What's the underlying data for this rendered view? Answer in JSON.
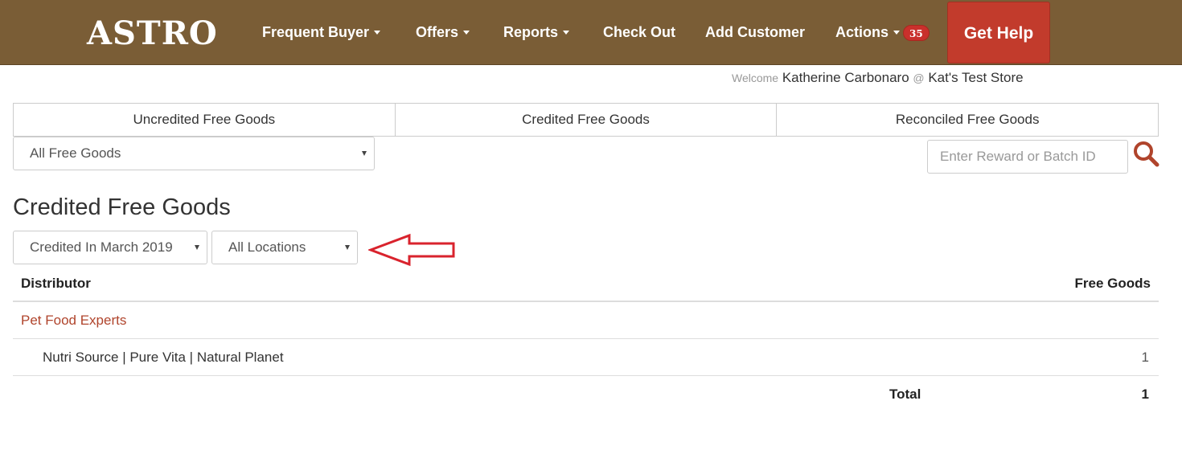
{
  "brand": {
    "logo": "ASTRO"
  },
  "nav": {
    "items": [
      {
        "label": "Frequent Buyer",
        "dropdown": true
      },
      {
        "label": "Offers",
        "dropdown": true
      },
      {
        "label": "Reports",
        "dropdown": true
      },
      {
        "label": "Check Out",
        "dropdown": false
      },
      {
        "label": "Add Customer",
        "dropdown": false
      },
      {
        "label": "Actions",
        "dropdown": true,
        "badge": "35"
      }
    ],
    "help_button": "Get Help"
  },
  "welcome": {
    "prefix": "Welcome",
    "user": "Katherine Carbonaro",
    "at": "@",
    "store": "Kat's Test Store"
  },
  "tabs": [
    {
      "label": "Uncredited Free Goods"
    },
    {
      "label": "Credited Free Goods"
    },
    {
      "label": "Reconciled Free Goods"
    }
  ],
  "filters": {
    "type_select": "All Free Goods",
    "search_placeholder": "Enter Reward or Batch ID",
    "period_select": "Credited In March 2019",
    "location_select": "All Locations"
  },
  "page_title": "Credited Free Goods",
  "table": {
    "headers": {
      "distributor": "Distributor",
      "free_goods": "Free Goods"
    },
    "groups": [
      {
        "distributor": "Pet Food Experts",
        "rows": [
          {
            "name": "Nutri Source | Pure Vita | Natural Planet",
            "free_goods": "1"
          }
        ]
      }
    ],
    "total_label": "Total",
    "total_value": "1"
  },
  "colors": {
    "navbar": "#7a5d36",
    "help_button": "#c23b2c",
    "link": "#b0442c",
    "annotation_arrow": "#d9232d",
    "badge": "#c9302c"
  },
  "icons": {
    "search": "magnifier-icon",
    "annotation": "left-arrow-icon"
  }
}
